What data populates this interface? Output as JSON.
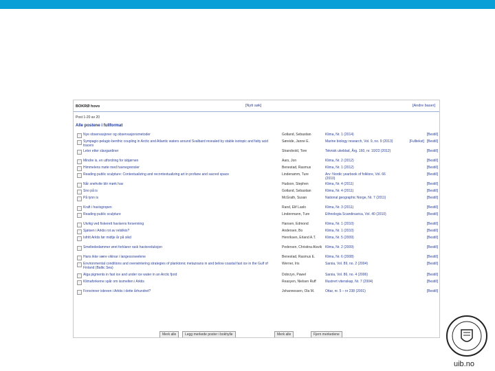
{
  "header": {
    "title": "BOKRØ hovo",
    "new_search": "[Nytt søk]",
    "other_bases": "[Andre baser]"
  },
  "position": "Post 1-20 av 20",
  "list_title": "Alle postene i fullformat",
  "rows": [
    {
      "title": "Nye observasjoner og observasjonsmetoder",
      "author": "Gotland, Sebastian",
      "source": "Klima, Nr. 1 (2014)",
      "actions": [
        "[Bestill]"
      ]
    },
    {
      "title": "Sympagic-pelagic-benthic coupling in Arctic and Atlantic waters around Svalbard revealed by stable isotopic and fatty acid tracers",
      "author": "Søreide, Janne E.",
      "source": "Marine biology research, Vol. 9, no. 9 (2013)",
      "actions": [
        "[Fulltekst]",
        "[Bestill]"
      ]
    },
    {
      "title": "Leter etter slavgardiner",
      "author": "Strandvold, Tore",
      "source": "Teknisk ukeblad, Årg. 160, nr. 10/22 (2012)",
      "actions": [
        "[Bestill]"
      ]
    },
    {
      "title": "Mindre is, en utfordring for isbjørnen",
      "author": "Aars, Jon",
      "source": "Klima, Nr. 2 (2012)",
      "actions": [
        "[Bestill]"
      ]
    },
    {
      "title": "Himmelens møte med havnegrensler",
      "author": "Benestad, Rasmus",
      "source": "Klima, Nr. 1 (2012)",
      "actions": [
        "[Bestill]"
      ]
    },
    {
      "title": "Reading public sculpture: Contextualizing and recontextualizing art in profane and sacred space",
      "author": "Lindenamm, Ture",
      "source": "Arv: Nordic yearbook of folklore, Vol. 66 (2010)",
      "actions": [
        "[Bestill]"
      ]
    },
    {
      "title": "Når snehvite blir mørk hav",
      "author": "Hudson, Stephen",
      "source": "Klima, Nr. 4 (2011)",
      "actions": [
        "[Bestill]"
      ]
    },
    {
      "title": "Sno på is",
      "author": "Gotland, Sebastian",
      "source": "Klima, Nr. 4 (2011)",
      "actions": [
        "[Bestill]"
      ]
    },
    {
      "title": "På tynn is",
      "author": "McGrath, Susan",
      "source": "National geographic Norge, Nr. 7 (2011)",
      "actions": [
        "[Bestill]"
      ]
    },
    {
      "title": "Kraft i havisgropen",
      "author": "Rand, Elif Laslo",
      "source": "Klima, Nr. 3 (2011)",
      "actions": [
        "[Bestill]"
      ]
    },
    {
      "title": "Reading public sculpture",
      "author": "Lindenmann, Ture",
      "source": "Ethnologia Scandinavica, Vol. 40 (2010)",
      "actions": [
        "[Bestill]"
      ]
    },
    {
      "title": "Utvikg ved fiskerett havisens forsenning",
      "author": "Hansen, Edmond",
      "source": "Klima, Nr. 1 (2010)",
      "actions": [
        "[Bestill]"
      ]
    },
    {
      "title": "Sjøisen i Arktis rot av relslikis?",
      "author": "Andersen, Bo",
      "source": "Klima, Nr. 1 (2010)",
      "actions": [
        "[Bestill]"
      ]
    },
    {
      "title": "Isfritt Arktis før midtje år på sikd",
      "author": "Henriksen, Erland A.T.",
      "source": "Klima, Nr. 5 (2009)",
      "actions": [
        "[Bestill]"
      ]
    },
    {
      "title": "Smeltededammer øret forklarer rask havisreduksjon",
      "author": "Pedersen, Christina Alsvik",
      "source": "Klima, Nr. 2 (2009)",
      "actions": [
        "[Bestill]"
      ]
    },
    {
      "title": "Hans ikke være vikinar i langessrseelene",
      "author": "Benestad, Rasmus E.",
      "source": "Klima, Nr. 6 (2008)",
      "actions": [
        "[Bestill]"
      ]
    },
    {
      "title": "Environmental conditions and overwintering strategies of planktonic metazoans in and below coastal fast ice in the Gulf of Finland (Baltic Sea)",
      "author": "Werner, Iris",
      "source": "Sarsia, Vol. 89, no. 2 (2004)",
      "actions": [
        "[Bestill]"
      ]
    },
    {
      "title": "Alga pigments in fast ice and under ice water in an Arctic fjord",
      "author": "Dobrzyn, Pawel",
      "source": "Sarsia, Vol. 86, no. 4 (2006)",
      "actions": [
        "[Bestill]"
      ]
    },
    {
      "title": "Klimaforkerne spår om issmelten i Arktis",
      "author": "Reasyen, Nielsen Ruff",
      "source": "Illustrert vitenskap, Nr. 7 (2004)",
      "actions": [
        "[Bestill]"
      ]
    },
    {
      "title": "Forsvinner isbreen i Arktis i dette århundret?",
      "author": "Johannessen, Ola M.",
      "source": "Ottar, nr. 5 – nr 238 (2001)",
      "actions": [
        "[Bestill]"
      ]
    }
  ],
  "buttons": [
    "Merk alle",
    "Legg merkede poster i bokhylle",
    "Merk alle",
    "Fjern merkedene"
  ],
  "brand": {
    "text": "uib.no",
    "accent": "#0a9fd6"
  }
}
